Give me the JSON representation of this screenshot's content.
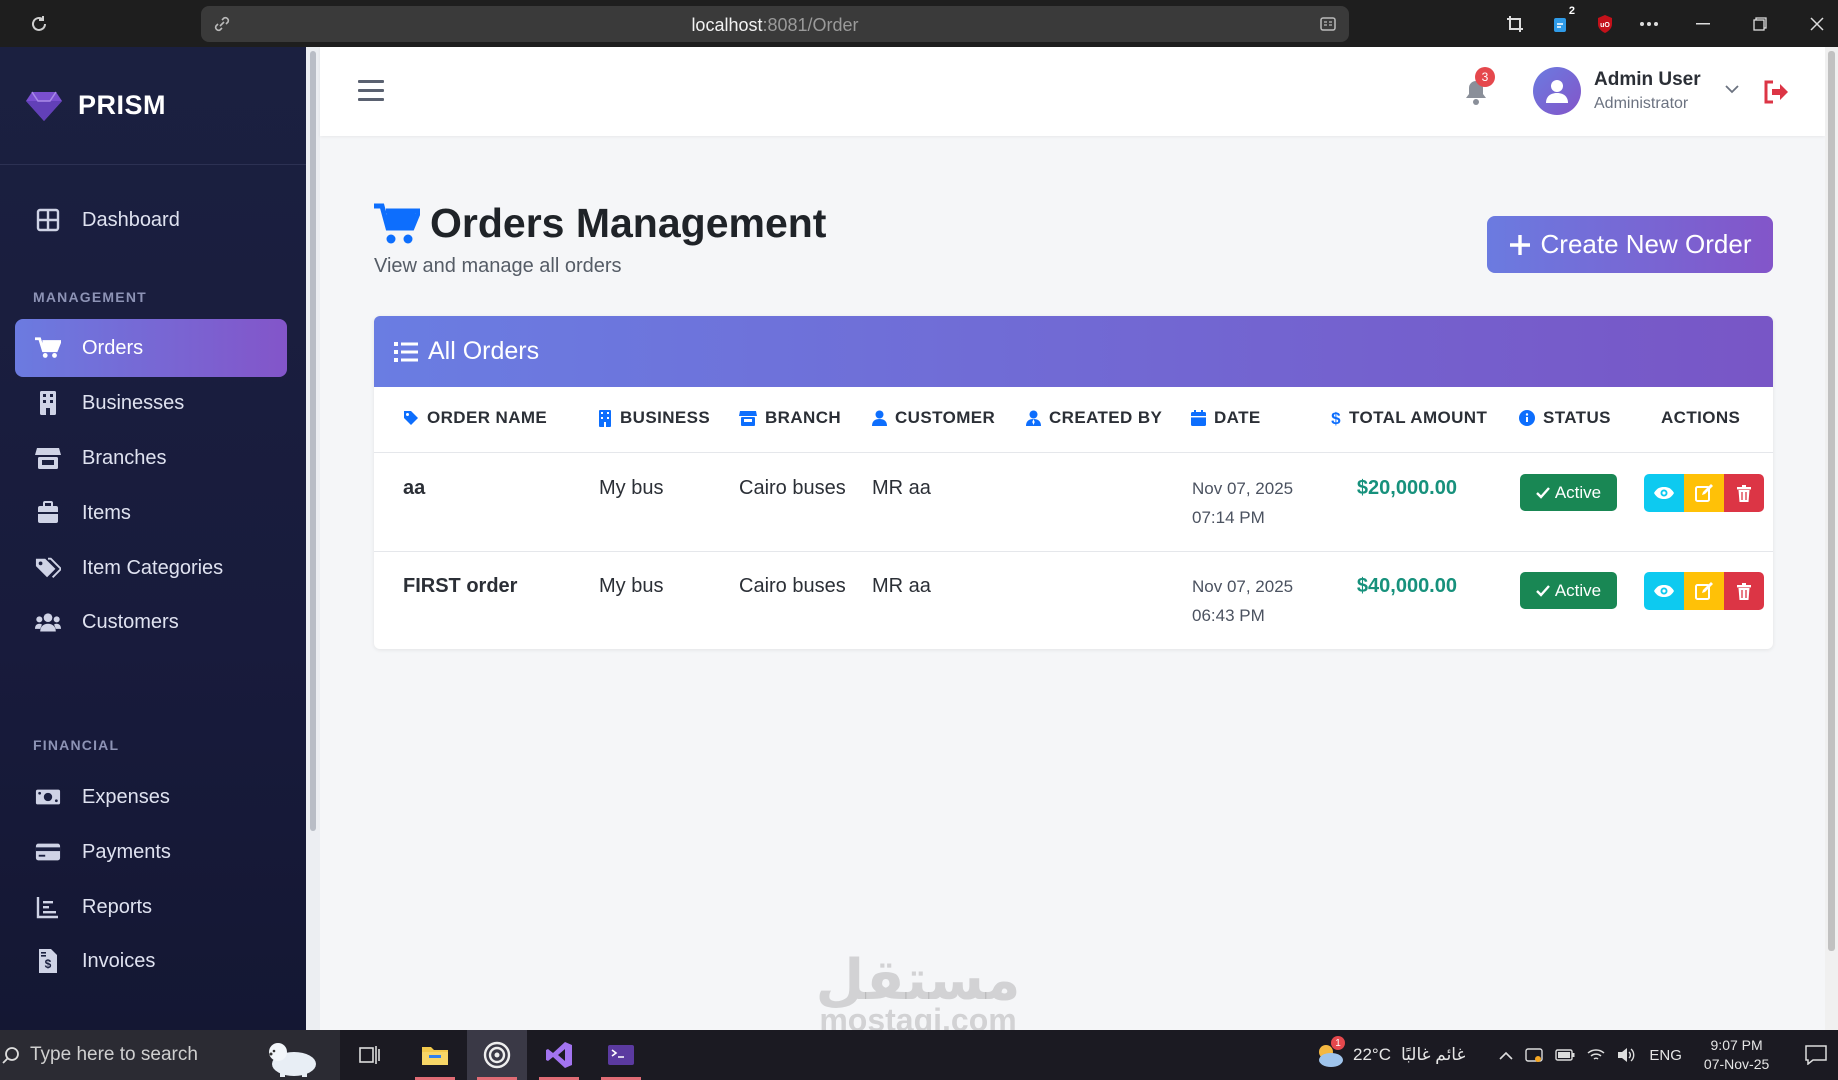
{
  "browser": {
    "url_host": "localhost",
    "url_rest": ":8081/Order",
    "extension_badge": "2"
  },
  "sidebar": {
    "brand": "PRISM",
    "dashboard": "Dashboard",
    "section_management": "MANAGEMENT",
    "section_financial": "FINANCIAL",
    "items": [
      {
        "label": "Orders",
        "icon": "cart-icon",
        "active": true
      },
      {
        "label": "Businesses",
        "icon": "building-icon"
      },
      {
        "label": "Branches",
        "icon": "store-icon"
      },
      {
        "label": "Items",
        "icon": "box-icon"
      },
      {
        "label": "Item Categories",
        "icon": "tags-icon"
      },
      {
        "label": "Customers",
        "icon": "users-icon"
      },
      {
        "label": "Expenses",
        "icon": "money-icon"
      },
      {
        "label": "Payments",
        "icon": "credit-card-icon"
      },
      {
        "label": "Reports",
        "icon": "chart-icon"
      },
      {
        "label": "Invoices",
        "icon": "invoice-icon"
      }
    ]
  },
  "topbar": {
    "notification_count": "3",
    "user_name": "Admin User",
    "user_role": "Administrator"
  },
  "page": {
    "title": "Orders Management",
    "subtitle": "View and manage all orders",
    "create_button": "Create New Order"
  },
  "table": {
    "title": "All Orders",
    "columns": [
      "ORDER NAME",
      "BUSINESS",
      "BRANCH",
      "CUSTOMER",
      "CREATED BY",
      "DATE",
      "TOTAL AMOUNT",
      "STATUS",
      "ACTIONS"
    ],
    "rows": [
      {
        "order_name": "aa",
        "business": "My bus",
        "branch": "Cairo buses",
        "customer": "MR aa",
        "created_by": "",
        "date": "Nov 07, 2025",
        "time": "07:14 PM",
        "amount": "$20,000.00",
        "status": "Active"
      },
      {
        "order_name": "FIRST order",
        "business": "My bus",
        "branch": "Cairo buses",
        "customer": "MR aa",
        "created_by": "",
        "date": "Nov 07, 2025",
        "time": "06:43 PM",
        "amount": "$40,000.00",
        "status": "Active"
      }
    ]
  },
  "taskbar": {
    "search_placeholder": "Type here to search",
    "weather_temp": "22°C",
    "weather_text": "غائم غالبًا",
    "weather_badge": "1",
    "language": "ENG",
    "time": "9:07 PM",
    "date": "07-Nov-25"
  },
  "watermark": {
    "arabic": "مستقل",
    "latin": "mostaqi.com"
  },
  "colors": {
    "sidebar_bg": "#181b3c",
    "accent_start": "#6b7be0",
    "accent_end": "#8355c9",
    "amount": "#17917c",
    "status_active": "#198754",
    "view_btn": "#0dcaf0",
    "edit_btn": "#ffc107",
    "delete_btn": "#dc3545",
    "logout": "#dc3545",
    "header_icon": "#0d6efd"
  }
}
